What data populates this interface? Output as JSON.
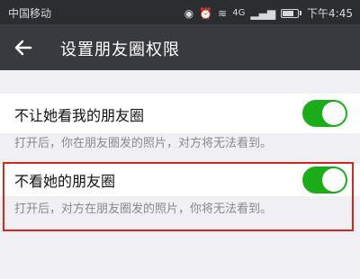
{
  "status_bar": {
    "carrier": "中国移动",
    "signal": "4G",
    "time": "下午4:45"
  },
  "app_bar": {
    "back_icon": "arrow-left-icon",
    "title": "设置朋友圈权限"
  },
  "settings": [
    {
      "label": "不让她看我的朋友圈",
      "enabled": true,
      "hint": "打开后，你在朋友圈发的照片，对方将无法看到。"
    },
    {
      "label": "不看她的朋友圈",
      "enabled": true,
      "hint": "打开后，对方在朋友圈发的照片，你将无法看到。"
    }
  ],
  "colors": {
    "status_bar_bg": "#2b2e31",
    "app_bar_bg": "#393a3f",
    "toggle_on": "#1aad19",
    "highlight": "#d9261c",
    "background": "#efeff4"
  }
}
